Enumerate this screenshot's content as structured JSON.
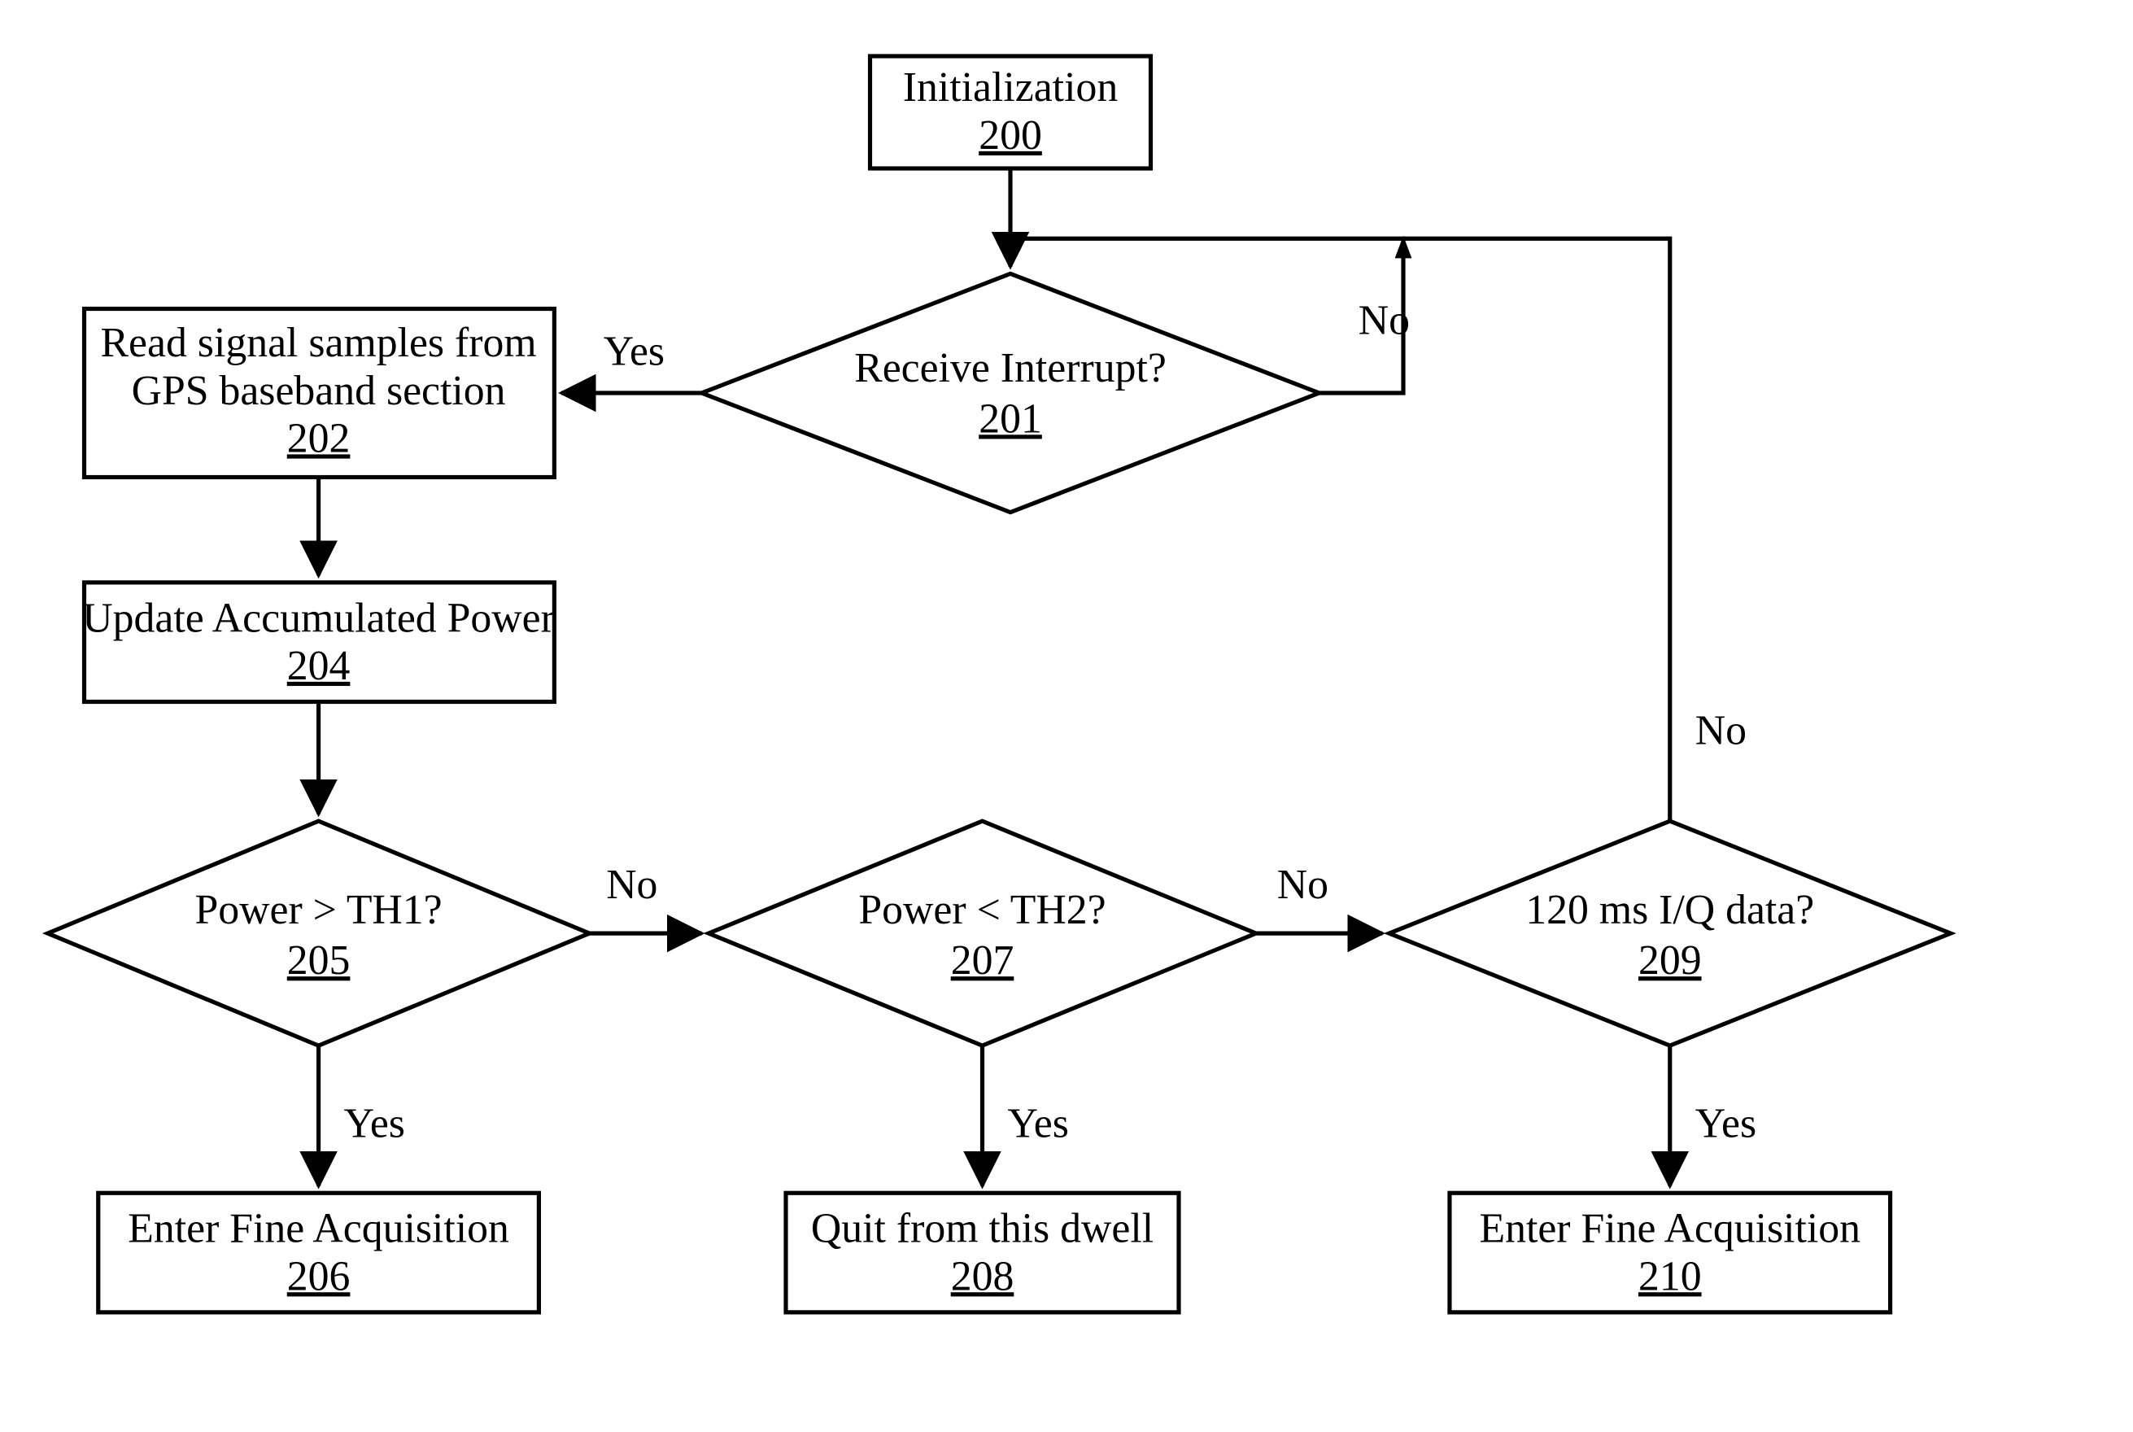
{
  "nodes": {
    "n200": {
      "ref": "200",
      "text": "Initialization"
    },
    "n201": {
      "ref": "201",
      "text": "Receive Interrupt?"
    },
    "n202": {
      "ref": "202",
      "line1": "Read signal samples from",
      "line2": "GPS baseband section"
    },
    "n204": {
      "ref": "204",
      "text": "Update Accumulated Power"
    },
    "n205": {
      "ref": "205",
      "text": "Power > TH1?"
    },
    "n206": {
      "ref": "206",
      "text": "Enter Fine Acquisition"
    },
    "n207": {
      "ref": "207",
      "text": "Power < TH2?"
    },
    "n208": {
      "ref": "208",
      "text": "Quit from this dwell"
    },
    "n209": {
      "ref": "209",
      "text": "120 ms I/Q data?"
    },
    "n210": {
      "ref": "210",
      "text": "Enter Fine Acquisition"
    }
  },
  "labels": {
    "yes": "Yes",
    "no": "No"
  },
  "chart_data": {
    "type": "flowchart",
    "nodes": [
      {
        "id": "200",
        "label": "Initialization",
        "shape": "rect"
      },
      {
        "id": "201",
        "label": "Receive Interrupt?",
        "shape": "decision"
      },
      {
        "id": "202",
        "label": "Read signal samples from GPS baseband section",
        "shape": "rect"
      },
      {
        "id": "204",
        "label": "Update Accumulated Power",
        "shape": "rect"
      },
      {
        "id": "205",
        "label": "Power > TH1?",
        "shape": "decision"
      },
      {
        "id": "206",
        "label": "Enter Fine Acquisition",
        "shape": "rect"
      },
      {
        "id": "207",
        "label": "Power < TH2?",
        "shape": "decision"
      },
      {
        "id": "208",
        "label": "Quit from this dwell",
        "shape": "rect"
      },
      {
        "id": "209",
        "label": "120 ms I/Q data?",
        "shape": "decision"
      },
      {
        "id": "210",
        "label": "Enter Fine Acquisition",
        "shape": "rect"
      }
    ],
    "edges": [
      {
        "from": "200",
        "to": "201",
        "label": ""
      },
      {
        "from": "201",
        "to": "202",
        "label": "Yes"
      },
      {
        "from": "201",
        "to": "201",
        "label": "No"
      },
      {
        "from": "202",
        "to": "204",
        "label": ""
      },
      {
        "from": "204",
        "to": "205",
        "label": ""
      },
      {
        "from": "205",
        "to": "206",
        "label": "Yes"
      },
      {
        "from": "205",
        "to": "207",
        "label": "No"
      },
      {
        "from": "207",
        "to": "208",
        "label": "Yes"
      },
      {
        "from": "207",
        "to": "209",
        "label": "No"
      },
      {
        "from": "209",
        "to": "210",
        "label": "Yes"
      },
      {
        "from": "209",
        "to": "201",
        "label": "No"
      }
    ]
  }
}
